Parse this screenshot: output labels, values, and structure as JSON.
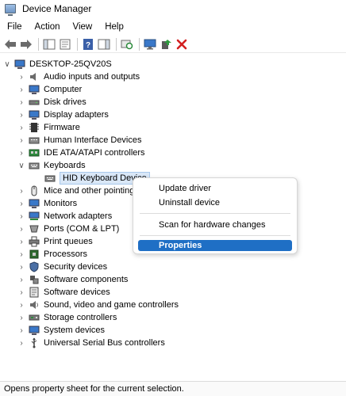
{
  "window": {
    "title": "Device Manager"
  },
  "menubar": {
    "items": [
      "File",
      "Action",
      "View",
      "Help"
    ]
  },
  "toolbar": {
    "buttons": [
      "back-icon",
      "forward-icon",
      "show-hide-console-tree-icon",
      "properties-icon",
      "help-icon",
      "action-pane-icon",
      "scan-hardware-icon",
      "monitor-icon",
      "update-driver-icon",
      "uninstall-icon"
    ]
  },
  "tree": {
    "root": "DESKTOP-25QV20S",
    "categories": [
      "Audio inputs and outputs",
      "Computer",
      "Disk drives",
      "Display adapters",
      "Firmware",
      "Human Interface Devices",
      "IDE ATA/ATAPI controllers",
      "Keyboards",
      "Mice and other pointing devices",
      "Monitors",
      "Network adapters",
      "Ports (COM & LPT)",
      "Print queues",
      "Processors",
      "Security devices",
      "Software components",
      "Software devices",
      "Sound, video and game controllers",
      "Storage controllers",
      "System devices",
      "Universal Serial Bus controllers"
    ],
    "selected_device": "HID Keyboard Device"
  },
  "context_menu": {
    "items": [
      "Update driver",
      "Uninstall device",
      "Scan for hardware changes",
      "Properties"
    ],
    "active": "Properties"
  },
  "status": {
    "text": "Opens property sheet for the current selection."
  },
  "colors": {
    "menu_highlight": "#1f6fc5",
    "selection_bg": "#d9e7f7",
    "delete_red": "#d32020",
    "device_blue": "#3a78c9"
  }
}
